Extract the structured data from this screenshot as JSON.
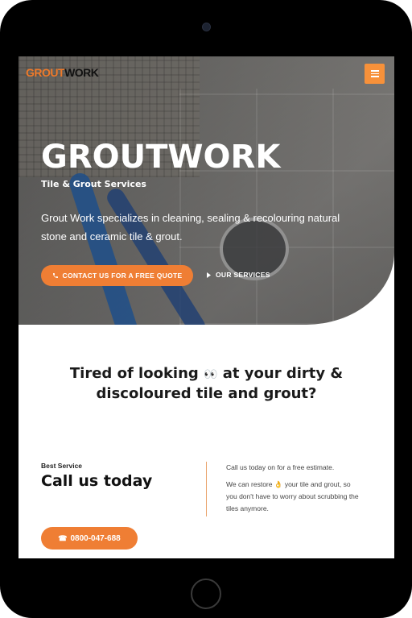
{
  "nav": {
    "logo_part1": "GROUT",
    "logo_part2": "WORK",
    "menu_icon": "hamburger-icon"
  },
  "hero": {
    "title": "GROUTWORK",
    "subtitle": "Tile & Grout Services",
    "description": "Grout Work specializes in cleaning, sealing & recolouring natural stone and ceramic tile & grout.",
    "cta_label": "CONTACT US FOR A FREE QUOTE",
    "cta_icon": "phone-icon",
    "services_label": "OUR SERVICES",
    "services_icon": "caret-right-icon"
  },
  "headline": {
    "part1": "Tired of looking",
    "emoji": "👀",
    "part2": "at your dirty &",
    "line2": "discoloured tile and grout?"
  },
  "service": {
    "label": "Best Service",
    "heading": "Call us today",
    "info_line1": "Call us today on for a free estimate.",
    "info_part1": "We can restore",
    "info_emoji": "👌",
    "info_part2": "your tile and grout, so you don't have to worry about scrubbing the tiles anymore.",
    "phone_label": "0800-047-688",
    "phone_icon": "telephone-icon"
  },
  "colors": {
    "accent": "#ef7e34",
    "menu_bg": "#f7913a",
    "divider": "#e9a36b",
    "device": "#000000"
  }
}
